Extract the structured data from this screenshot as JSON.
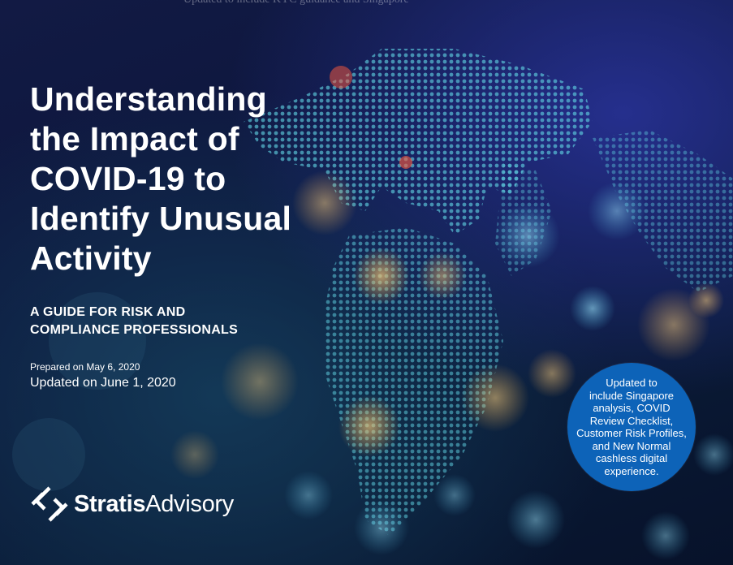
{
  "ghost_line": "Updated to include KYC guidance and Singapore",
  "title_lines": [
    "Understanding",
    "the Impact of",
    "COVID-19 to",
    "Identify Unusual",
    "Activity"
  ],
  "subtitle_lines": [
    "A GUIDE FOR RISK AND",
    "COMPLIANCE PROFESSIONALS"
  ],
  "prepared": "Prepared on May 6, 2020",
  "updated": "Updated on June 1, 2020",
  "badge_lines": [
    "Updated to",
    "include Singapore",
    "analysis, COVID",
    "Review Checklist,",
    "Customer Risk Profiles,",
    "and New Normal",
    "cashless digital",
    "experience."
  ],
  "logo": {
    "part1": "Stratis",
    "part2": "Advisory",
    "icon": "stratis-logo-icon"
  },
  "colors": {
    "badge": "#0d63b8",
    "background": "#0c163c",
    "dots": "#5fd0e0",
    "bokeh_orange": "#ffb347"
  }
}
